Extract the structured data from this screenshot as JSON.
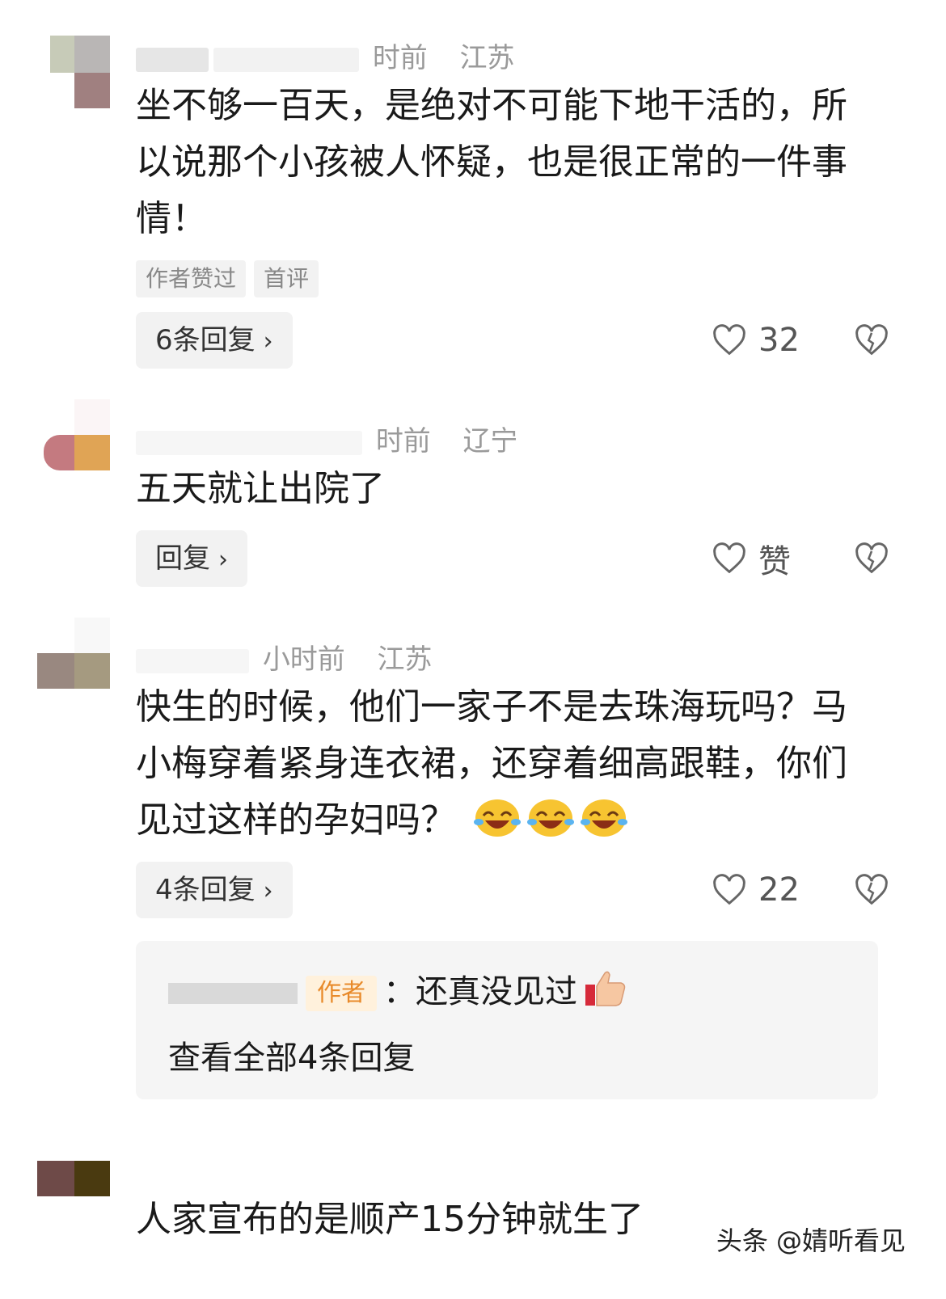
{
  "comments": [
    {
      "meta_time": "时前",
      "meta_location": "江苏",
      "text": "坐不够一百天，是绝对不可能下地干活的，所以说那个小孩被人怀疑，也是很正常的一件事情！",
      "tags": [
        "作者赞过",
        "首评"
      ],
      "reply_label": "6条回复",
      "likes": "32"
    },
    {
      "meta_time": "时前",
      "meta_location": "辽宁",
      "text": "五天就让出院了",
      "reply_label": "回复",
      "likes": "赞"
    },
    {
      "meta_time": "小时前",
      "meta_location": "江苏",
      "text": "快生的时候，他们一家子不是去珠海玩吗？马小梅穿着紧身连衣裙，还穿着细高跟鞋，你们见过这样的孕妇吗？",
      "reply_label": "4条回复",
      "likes": "22",
      "sub_reply": {
        "author_tag": "作者",
        "text": "：还真没见过",
        "view_all": "查看全部4条回复"
      }
    },
    {
      "text": "人家宣布的是顺产15分钟就生了"
    }
  ],
  "watermark": "头条 @婧听看见",
  "icons": {
    "like": "heart-outline-icon",
    "dislike": "broken-heart-icon",
    "chevron": "chevron-right-icon",
    "laugh": "laughing-emoji",
    "thumbs_up": "thumbs-up-emoji"
  },
  "colors": {
    "tag_bg": "#f2f2f2",
    "meta_gray": "#9a9a9a",
    "author_tag_text": "#e88a2a"
  }
}
